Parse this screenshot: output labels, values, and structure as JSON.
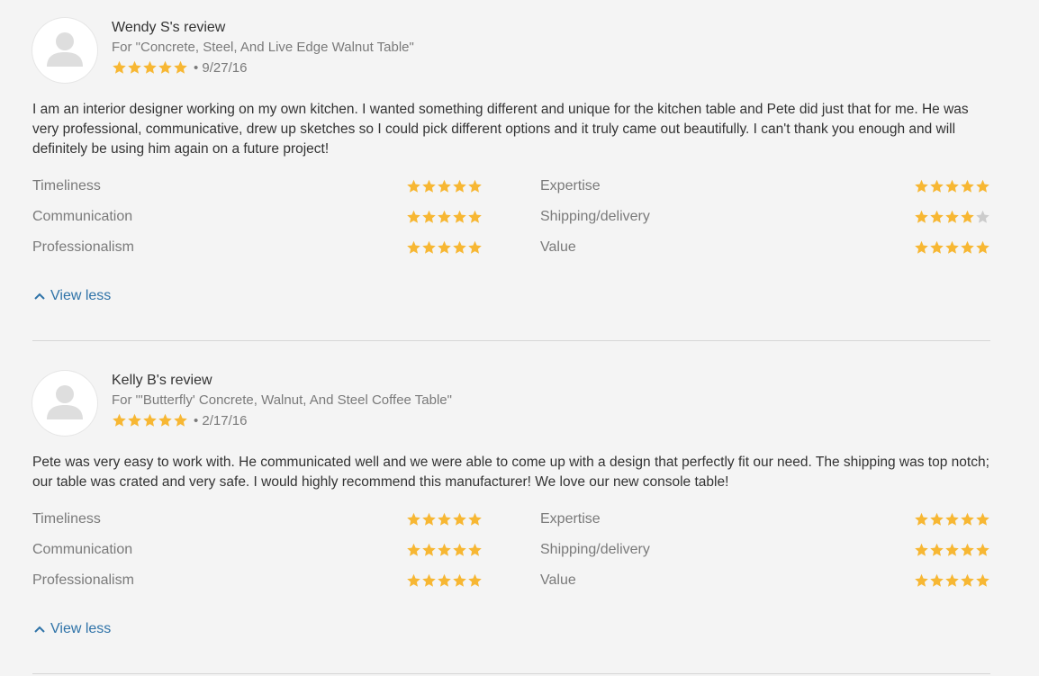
{
  "colors": {
    "star": "#f7b733",
    "star_empty": "#cccccc",
    "link": "#2f73a8"
  },
  "reviews": [
    {
      "name": "Wendy S's review",
      "product": "For \"Concrete, Steel, And Live Edge Walnut Table\"",
      "stars": 5,
      "date": "• 9/27/16",
      "text": "I am an interior designer working on my own kitchen. I wanted something different and unique for the kitchen table and Pete did just that for me. He was very professional, communicative, drew up sketches so I could pick different options and it truly came out beautifully. I can't thank you enough and will definitely be using him again on a future project!",
      "ratings": [
        {
          "label": "Timeliness",
          "stars": 5
        },
        {
          "label": "Expertise",
          "stars": 5
        },
        {
          "label": "Communication",
          "stars": 5
        },
        {
          "label": "Shipping/delivery",
          "stars": 4
        },
        {
          "label": "Professionalism",
          "stars": 5
        },
        {
          "label": "Value",
          "stars": 5
        }
      ],
      "toggle": "View less"
    },
    {
      "name": "Kelly B's review",
      "product": "For \"'Butterfly' Concrete, Walnut, And Steel Coffee Table\"",
      "stars": 5,
      "date": "• 2/17/16",
      "text": "Pete was very easy to work with. He communicated well and we were able to come up with a design that perfectly fit our need. The shipping was top notch; our table was crated and very safe. I would highly recommend this manufacturer! We love our new console table!",
      "ratings": [
        {
          "label": "Timeliness",
          "stars": 5
        },
        {
          "label": "Expertise",
          "stars": 5
        },
        {
          "label": "Communication",
          "stars": 5
        },
        {
          "label": "Shipping/delivery",
          "stars": 5
        },
        {
          "label": "Professionalism",
          "stars": 5
        },
        {
          "label": "Value",
          "stars": 5
        }
      ],
      "toggle": "View less"
    }
  ]
}
